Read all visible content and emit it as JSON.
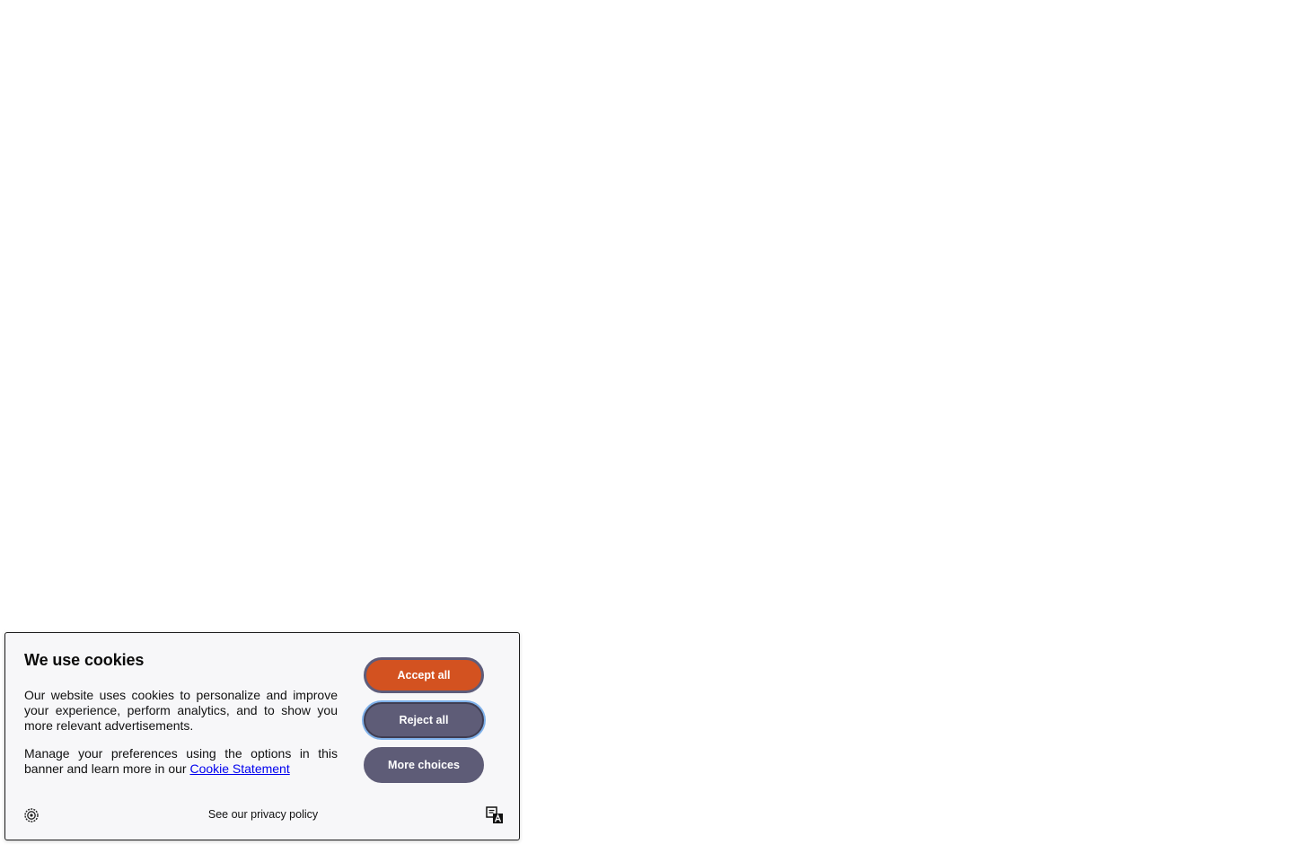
{
  "cookie_banner": {
    "title": "We use cookies",
    "paragraph_1": "Our website uses cookies to personalize and improve your experience, perform analytics, and to show you more relevant advertisements.",
    "paragraph_2_prefix": "Manage your preferences using the options in this banner and learn more in our ",
    "cookie_statement_link": "Cookie Statement",
    "buttons": {
      "accept_all": "Accept all",
      "reject_all": "Reject all",
      "more_choices": "More choices"
    },
    "footer": {
      "left_icon": "cookie-settings-icon",
      "privacy_link": "See our privacy policy",
      "right_icon": "translate-icon"
    },
    "colors": {
      "accent": "#d35220",
      "secondary_button": "#5e5c77",
      "focus_ring": "#7fb1ea",
      "link": "#0000ee",
      "background": "#f7f7f9"
    }
  }
}
